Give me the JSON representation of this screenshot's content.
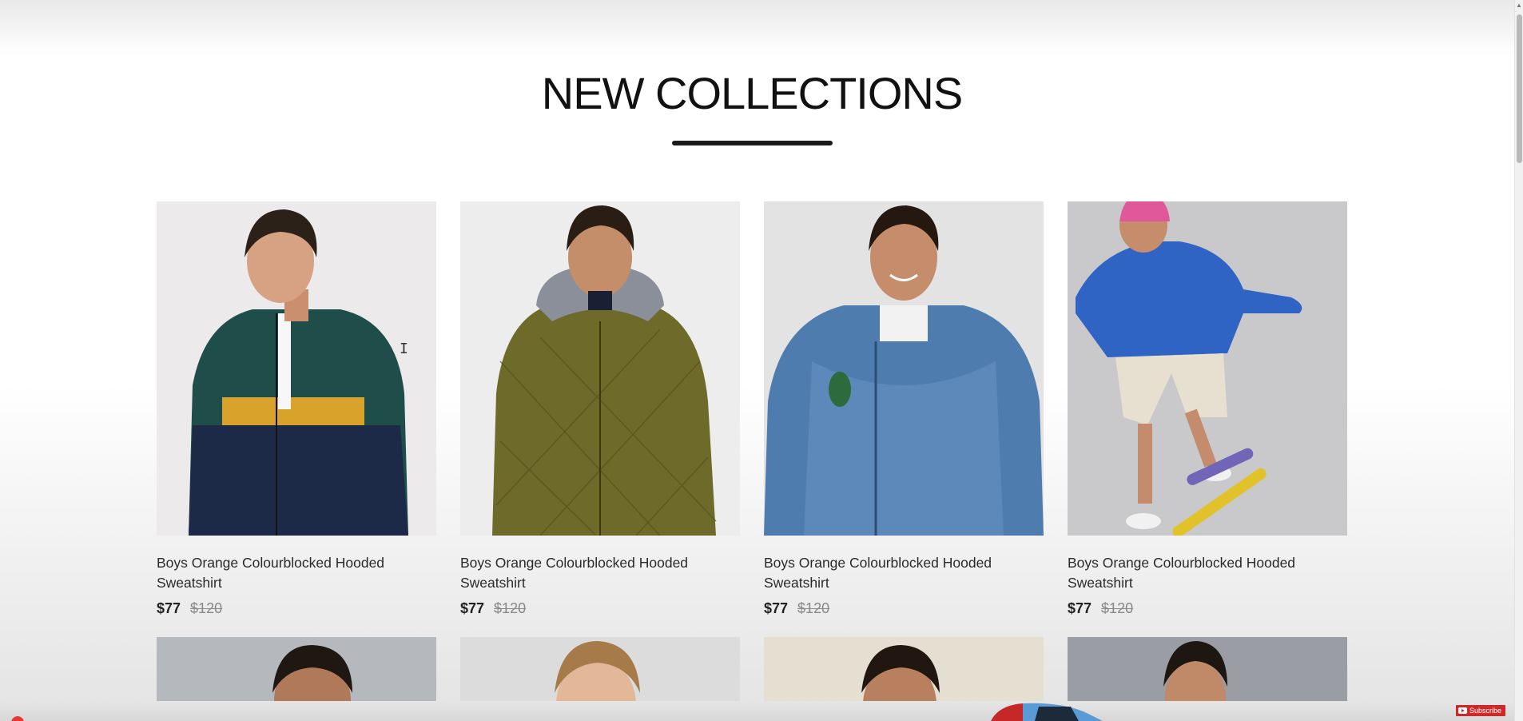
{
  "section": {
    "title": "NEW COLLECTIONS"
  },
  "products": [
    {
      "name": "Boys Orange Colourblocked Hooded Sweatshirt",
      "price": "$77",
      "old_price": "$120",
      "image": "boy-green-navy-track-jacket"
    },
    {
      "name": "Boys Orange Colourblocked Hooded Sweatshirt",
      "price": "$77",
      "old_price": "$120",
      "image": "boy-olive-quilted-hooded-jacket"
    },
    {
      "name": "Boys Orange Colourblocked Hooded Sweatshirt",
      "price": "$77",
      "old_price": "$120",
      "image": "boy-denim-bomber-jacket"
    },
    {
      "name": "Boys Orange Colourblocked Hooded Sweatshirt",
      "price": "$77",
      "old_price": "$120",
      "image": "boy-blue-sweatshirt-skateboard"
    }
  ],
  "next_row_images": [
    "boy-portrait-1",
    "boy-portrait-2",
    "boy-portrait-3",
    "boy-portrait-4"
  ],
  "overlay": {
    "subscribe_label": "Subscribe"
  },
  "colors": {
    "title": "#111111",
    "underline": "#1b1b1b",
    "strike_price": "#888888",
    "subscribe_bg": "#cc2a2a"
  }
}
